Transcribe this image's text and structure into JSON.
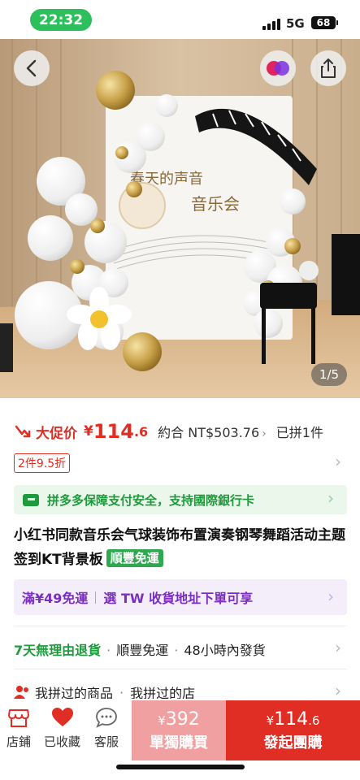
{
  "status_bar": {
    "time": "22:32",
    "network": "5G",
    "battery": "68"
  },
  "hero": {
    "counter": "1/5",
    "backdrop_line1": "春天的声音",
    "backdrop_line2": "音乐会"
  },
  "price": {
    "promo_label": "大促价",
    "currency": "¥",
    "integer": "114",
    "decimal": ".6",
    "approx": "約合 NT$503.76",
    "joined": "已拼1件"
  },
  "discount_tag": "2件9.5折",
  "assurance": "拼多多保障支付安全，支持國際銀行卡",
  "title": {
    "text": "小红书同款音乐会气球装饰布置演奏钢琴舞蹈活动主题签到KT背景板",
    "badge": "順豐免運"
  },
  "shipping": {
    "left": "滿¥49免運",
    "right": "選 TW 收貨地址下單可享"
  },
  "services": {
    "return": "7天無理由退貨",
    "sf": "順豐免運",
    "dispatch": "48小時內發貨"
  },
  "history": {
    "left": "我拼过的商品",
    "right": "我拼过的店"
  },
  "bottom_bar": {
    "store": "店鋪",
    "saved": "已收藏",
    "service": "客服",
    "solo_currency": "¥",
    "solo_price": "392",
    "solo_label": "單獨購買",
    "group_currency": "¥",
    "group_price_int": "114",
    "group_price_dec": ".6",
    "group_label": "發起團購"
  },
  "colors": {
    "accent_red": "#e02e24",
    "green": "#1f9a3c",
    "purple": "#7a2fbf"
  },
  "icons": [
    "back-icon",
    "brand-logo-icon",
    "share-icon",
    "price-down-icon",
    "card-icon",
    "chevron-right-icon",
    "user-icon",
    "store-icon",
    "heart-icon",
    "chat-icon"
  ]
}
